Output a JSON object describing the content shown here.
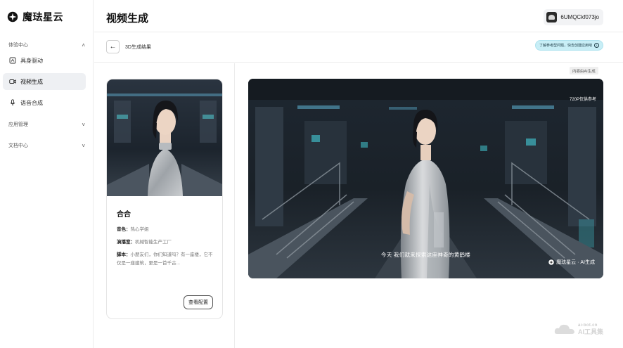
{
  "brand": {
    "name": "魔珐星云",
    "logo_icon": "brand-logo-icon"
  },
  "sidebar": {
    "groups": [
      {
        "label": "体验中心",
        "chevron": "˄"
      },
      {
        "label": "应用管理",
        "chevron": "˅"
      },
      {
        "label": "文档中心",
        "chevron": "˅"
      }
    ],
    "items": [
      {
        "label": "具身驱动",
        "icon": "home-icon",
        "active": false
      },
      {
        "label": "视频生成",
        "icon": "video-icon",
        "active": true
      },
      {
        "label": "语音合成",
        "icon": "microphone-icon",
        "active": false
      }
    ]
  },
  "header": {
    "title": "视频生成",
    "username": "6UMQCkf073jo"
  },
  "subbar": {
    "back_glyph": "←",
    "title": "3D生成结果",
    "tip": "了解参考型问题，快去创建应用吧",
    "tip_arrow": "›"
  },
  "card": {
    "name": "合合",
    "rows": [
      {
        "key": "音色：",
        "value": "热心学姐"
      },
      {
        "key": "演播室：",
        "value": "机械智能生产工厂"
      },
      {
        "key": "脚本：",
        "value": "小朋友们，你们知道吗？有一座楼，它不仅是一座建筑，更是一首千古..."
      }
    ],
    "button": "查看配置"
  },
  "video": {
    "ai_tag": "内容由AI生成",
    "resolution_note": "720P仅供参考",
    "subtitle": "今天 我们就来探索这座神奇的黄鹤楼",
    "watermark": "魔珐星云 · AI生成"
  },
  "corner_watermark": {
    "url": "ai-bot.cn",
    "text": "AI工具集"
  },
  "colors": {
    "accent_tip_bg": "#c8eef6",
    "active_nav_bg": "#eef0f3"
  }
}
